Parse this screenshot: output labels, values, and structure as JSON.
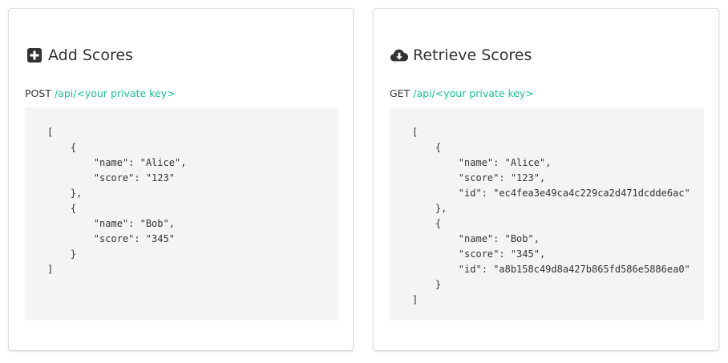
{
  "add_card": {
    "title": "Add Scores",
    "icon": "plus-square-icon",
    "method": "POST",
    "path": "/api/<your private key>",
    "code_lines": [
      "[",
      "    {",
      "        \"name\": \"Alice\",",
      "        \"score\": \"123\"",
      "    },",
      "    {",
      "        \"name\": \"Bob\",",
      "        \"score\": \"345\"",
      "    }",
      "]"
    ]
  },
  "retrieve_card": {
    "title": "Retrieve Scores",
    "icon": "cloud-download-icon",
    "method": "GET",
    "path": "/api/<your private key>",
    "code_lines": [
      "[",
      "    {",
      "        \"name\": \"Alice\",",
      "        \"score\": \"123\",",
      "        \"id\": \"ec4fea3e49ca4c229ca2d471dcdde6ac\"",
      "    },",
      "    {",
      "        \"name\": \"Bob\",",
      "        \"score\": \"345\",",
      "        \"id\": \"a8b158c49d8a427b865fd586e5886ea0\"",
      "    }",
      "]"
    ]
  },
  "colors": {
    "accent": "#1abc9c",
    "code_background": "#f4f4f4",
    "text": "#333333"
  }
}
